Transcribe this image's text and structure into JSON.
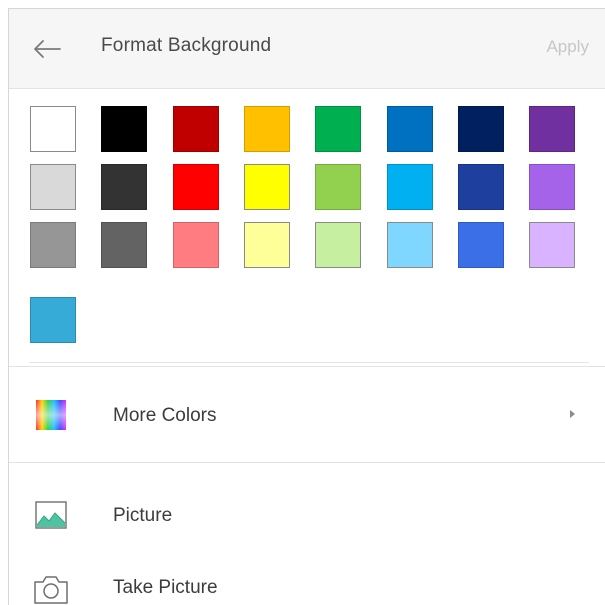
{
  "header": {
    "title": "Format Background",
    "apply_label": "Apply",
    "back_icon": "arrow-left-icon"
  },
  "palette": {
    "rows": [
      [
        "#ffffff",
        "#000000",
        "#c00000",
        "#ffc000",
        "#00b050",
        "#0070c0",
        "#002060",
        "#7030a0"
      ],
      [
        "#d9d9d9",
        "#333333",
        "#ff0000",
        "#ffff00",
        "#92d050",
        "#00b0f0",
        "#1f3f9f",
        "#a463e8"
      ],
      [
        "#969696",
        "#636363",
        "#ff7c80",
        "#ffff99",
        "#c6efa0",
        "#7fd7ff",
        "#3a6fe8",
        "#d9b3ff"
      ]
    ],
    "recent": [
      "#36abd7"
    ]
  },
  "menu": {
    "more_colors": {
      "label": "More Colors",
      "icon": "color-spectrum-icon"
    },
    "picture": {
      "label": "Picture",
      "icon": "image-icon"
    },
    "take_picture": {
      "label": "Take Picture",
      "icon": "camera-icon"
    }
  }
}
